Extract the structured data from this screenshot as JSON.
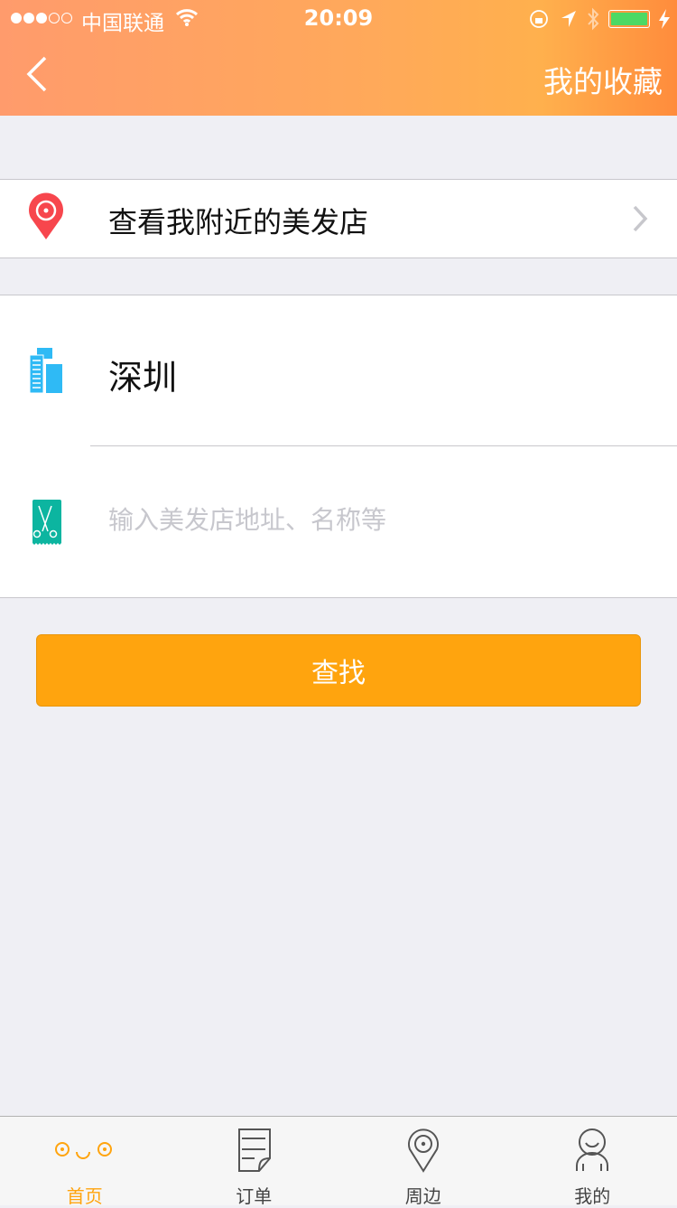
{
  "status": {
    "carrier": "中国联通",
    "time": "20:09",
    "signal_dots": 3,
    "battery_color": "#4cd964"
  },
  "nav": {
    "title": "我的收藏",
    "back_icon": "chevron-left-icon"
  },
  "nearby": {
    "label": "查看我附近的美发店",
    "icon": "location-pin-icon"
  },
  "form": {
    "city": "深圳",
    "search_placeholder": "输入美发店地址、名称等",
    "search_value": ""
  },
  "button": {
    "label": "查找",
    "color": "#ffa40e"
  },
  "tabs": [
    {
      "label": "首页",
      "icon": "face-icon",
      "active": true
    },
    {
      "label": "订单",
      "icon": "document-icon"
    },
    {
      "label": "周边",
      "icon": "location-icon"
    },
    {
      "label": "我的",
      "icon": "person-icon"
    }
  ]
}
